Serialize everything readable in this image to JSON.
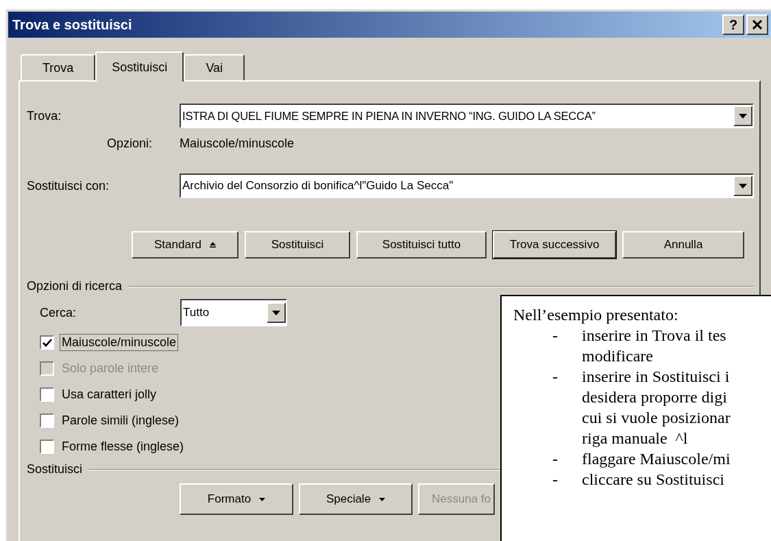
{
  "window": {
    "title": "Trova e sostituisci",
    "help_button": "?"
  },
  "tabs": [
    {
      "label": "Trova",
      "selected": false
    },
    {
      "label": "Sostituisci",
      "selected": true
    },
    {
      "label": "Vai",
      "selected": false
    }
  ],
  "find": {
    "label": "Trova:",
    "value": "ISTRA DI QUEL FIUME SEMPRE IN PIENA IN INVERNO “ING. GUIDO LA SECCA”",
    "options_label": "Opzioni:",
    "options_value": "Maiuscole/minuscole"
  },
  "replace": {
    "label": "Sostituisci con:",
    "value": "Archivio del Consorzio di bonifica^l\"Guido La Secca\""
  },
  "buttons": [
    {
      "label": "Standard",
      "kind": "toggle",
      "default": false
    },
    {
      "label": "Sostituisci",
      "kind": "plain",
      "default": false
    },
    {
      "label": "Sostituisci tutto",
      "kind": "plain",
      "default": false
    },
    {
      "label": "Trova successivo",
      "kind": "plain",
      "default": true
    },
    {
      "label": "Annulla",
      "kind": "plain",
      "default": false
    }
  ],
  "search_options": {
    "title": "Opzioni di ricerca",
    "search_label": "Cerca:",
    "search_value": "Tutto",
    "checkboxes": [
      {
        "label": "Maiuscole/minuscole",
        "checked": true,
        "disabled": false,
        "focused": true
      },
      {
        "label": "Solo parole intere",
        "checked": false,
        "disabled": true,
        "focused": false
      },
      {
        "label": "Usa caratteri jolly",
        "checked": false,
        "disabled": false,
        "focused": false
      },
      {
        "label": "Parole simili (inglese)",
        "checked": false,
        "disabled": false,
        "focused": false
      },
      {
        "label": "Forme flesse (inglese)",
        "checked": false,
        "disabled": false,
        "focused": false
      }
    ]
  },
  "replace_section": {
    "title": "Sostituisci",
    "buttons": [
      {
        "label": "Formato",
        "kind": "menu",
        "disabled": false
      },
      {
        "label": "Speciale",
        "kind": "menu",
        "disabled": false
      },
      {
        "label": "Nessuna fo",
        "kind": "plain",
        "disabled": true
      }
    ]
  },
  "note": {
    "heading": "Nell’esempio presentato:",
    "items": [
      {
        "marker": "-",
        "lines": [
          "inserire in Trova il tes",
          "modificare"
        ]
      },
      {
        "marker": "-",
        "lines": [
          "inserire in Sostituisci i",
          "desidera proporre digi",
          "cui si vuole posizionar",
          "riga manuale  ^l"
        ]
      },
      {
        "marker": "-",
        "lines": [
          "flaggare Maiuscole/mi"
        ]
      },
      {
        "marker": "-",
        "lines": [
          "cliccare su Sostituisci"
        ]
      }
    ]
  }
}
